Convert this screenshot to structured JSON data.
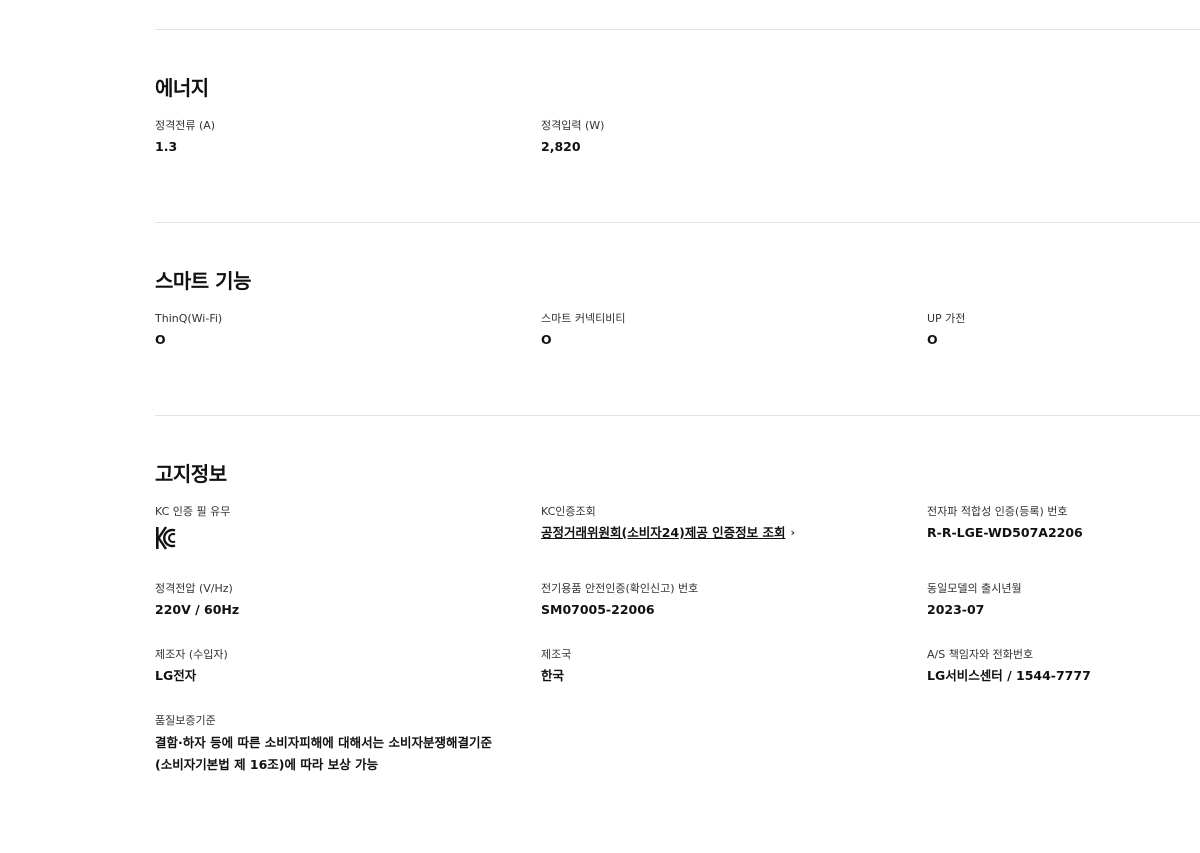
{
  "sections": {
    "energy": {
      "title": "에너지",
      "items": [
        {
          "label": "정격전류 (A)",
          "value": "1.3"
        },
        {
          "label": "정격입력 (W)",
          "value": "2,820"
        }
      ]
    },
    "smart": {
      "title": "스마트 기능",
      "items": [
        {
          "label": "ThinQ(Wi-Fi)",
          "value": "O"
        },
        {
          "label": "스마트 커넥티비티",
          "value": "O"
        },
        {
          "label": "UP 가전",
          "value": "O"
        }
      ]
    },
    "notice": {
      "title": "고지정보",
      "kc_cert": {
        "label": "KC 인증 필 유무",
        "icon": "kc-mark-icon"
      },
      "kc_lookup": {
        "label": "KC인증조회",
        "link_text": "공정거래위원회(소비자24)제공 인증정보 조회",
        "icon": "chevron-right-icon"
      },
      "emc": {
        "label": "전자파 적합성 인증(등록) 번호",
        "value": "R-R-LGE-WD507A2206"
      },
      "voltage": {
        "label": "정격전압 (V/Hz)",
        "value": "220V / 60Hz"
      },
      "safety": {
        "label": "전기용품 안전인증(확인신고) 번호",
        "value": "SM07005-22006"
      },
      "release": {
        "label": "동일모델의 출시년월",
        "value": "2023-07"
      },
      "maker": {
        "label": "제조자 (수입자)",
        "value": "LG전자"
      },
      "origin": {
        "label": "제조국",
        "value": "한국"
      },
      "as": {
        "label": "A/S 책임자와 전화번호",
        "value": "LG서비스센터 / 1544-7777"
      },
      "warranty": {
        "label": "품질보증기준",
        "line1": "결함·하자 등에 따른 소비자피해에 대해서는 소비자분쟁해결기준",
        "line2": "(소비자기본법 제 16조)에 따라 보상 가능"
      }
    }
  }
}
